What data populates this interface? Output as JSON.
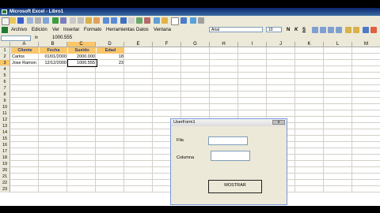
{
  "window": {
    "title": "Microsoft Excel - Libro1"
  },
  "menu": [
    "Archivo",
    "Edición",
    "Ver",
    "Insertar",
    "Formato",
    "Herramientas",
    "Datos",
    "Ventana"
  ],
  "font": {
    "name": "Arial",
    "size": "10"
  },
  "format_buttons": [
    "N",
    "K",
    "S"
  ],
  "formula_bar": {
    "name_box": "",
    "fx": "fx",
    "value": "1000.555"
  },
  "columns": [
    "A",
    "B",
    "C",
    "D",
    "E",
    "F",
    "G",
    "H",
    "I",
    "J",
    "K",
    "L",
    "M"
  ],
  "rows": [
    "1",
    "2",
    "3",
    "4",
    "5",
    "6",
    "7",
    "8",
    "9",
    "10",
    "11",
    "12",
    "13",
    "14",
    "15",
    "16",
    "17",
    "18",
    "19",
    "20",
    "21",
    "22",
    "23"
  ],
  "table": {
    "headers": [
      "Cliente",
      "Fecha",
      "Sueldo",
      "Edad"
    ],
    "rows": [
      [
        "Carlos",
        "01/01/2000",
        "2000.000",
        "18"
      ],
      [
        "Jose Ramon",
        "12/12/2000",
        "1000.555",
        "23"
      ]
    ]
  },
  "dialog": {
    "title": "UserForm1",
    "close": "x",
    "label_fila": "Fila",
    "label_columna": "Columna",
    "button": "MOSTRAR"
  },
  "colors": {
    "header_fill": "#f9c66a",
    "title_bar": "#0a246a"
  }
}
